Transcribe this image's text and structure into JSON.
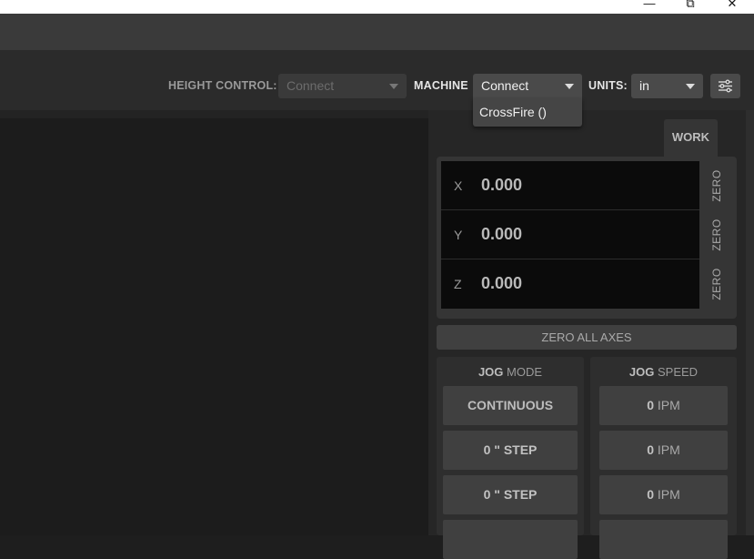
{
  "window": {
    "minimize_glyph": "—",
    "maximize_glyph": "⧉",
    "close_glyph": "✕"
  },
  "toolbar": {
    "height_control_label": "HEIGHT CONTROL:",
    "height_control_value": "Connect",
    "machine_label": "MACHINE",
    "machine_value": "Connect",
    "units_label": "UNITS:",
    "units_value": "in",
    "settings_icon": "sliders-icon"
  },
  "machine_dropdown": {
    "options": [
      "CrossFire ()"
    ]
  },
  "panel": {
    "tab_work": "WORK",
    "axes": [
      {
        "label": "X",
        "value": "0.000",
        "zero": "ZERO"
      },
      {
        "label": "Y",
        "value": "0.000",
        "zero": "ZERO"
      },
      {
        "label": "Z",
        "value": "0.000",
        "zero": "ZERO"
      }
    ],
    "zero_all": "ZERO ALL AXES"
  },
  "jog_mode": {
    "title_bold": "JOG",
    "title_rest": " MODE",
    "buttons": [
      "CONTINUOUS",
      "0 \" STEP",
      "0 \" STEP"
    ]
  },
  "jog_speed": {
    "title_bold": "JOG",
    "title_rest": " SPEED",
    "buttons": [
      {
        "value": "0",
        "unit": " IPM"
      },
      {
        "value": "0",
        "unit": " IPM"
      },
      {
        "value": "0",
        "unit": " IPM"
      }
    ]
  },
  "colors": {
    "background": "#1e1e1e",
    "toolbar": "#2b2b2b",
    "dro_background": "#0b0b0b",
    "button": "#404040"
  }
}
